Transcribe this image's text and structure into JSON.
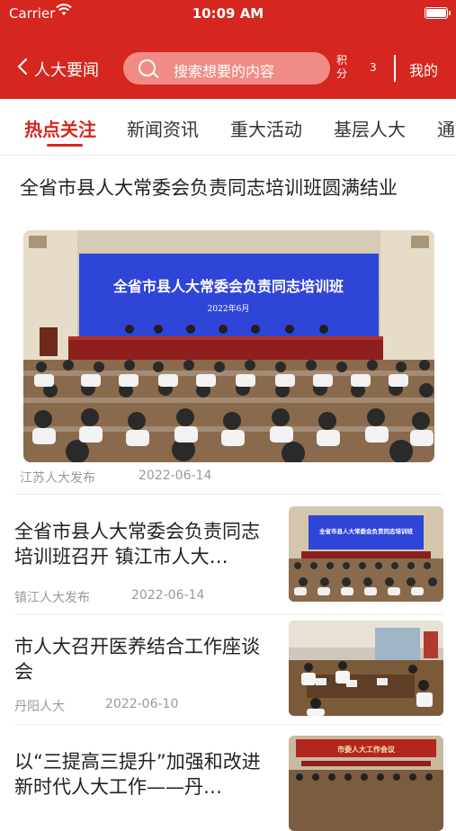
{
  "status_bar": {
    "carrier": "Carrier",
    "time": "10:09 AM",
    "battery_level": 1.0
  },
  "nav": {
    "back_label": "人大要闻",
    "search_placeholder": "搜索想要的内容",
    "points_label": "积分",
    "points_value": "3",
    "mine_label": "我的"
  },
  "tabs": [
    {
      "label": "热点关注",
      "active": true
    },
    {
      "label": "新闻资讯",
      "active": false
    },
    {
      "label": "重大活动",
      "active": false
    },
    {
      "label": "基层人大",
      "active": false
    },
    {
      "label": "通",
      "active": false
    }
  ],
  "feature": {
    "title": "全省市县人大常委会负责同志培训班圆满结业",
    "banner_text": "全省市县人大常委会负责同志培训班",
    "banner_date": "2022年6月",
    "source": "江苏人大发布",
    "date": "2022-06-14"
  },
  "articles": [
    {
      "title": "全省市县人大常委会负责同志培训班召开 镇江市人大…",
      "source": "镇江人大发布",
      "date": "2022-06-14",
      "thumb_banner": "全省市县人大常委会负责同志培训班"
    },
    {
      "title": "市人大召开医养结合工作座谈会",
      "source": "丹阳人大",
      "date": "2022-06-10"
    },
    {
      "title": "以“三提高三提升”加强和改进新时代人大工作——丹…",
      "thumb_banner": "市委人大工作会议"
    }
  ],
  "colors": {
    "brand_red": "#d5271f",
    "search_bg": "#f08c86",
    "banner_blue": "#2f45d8"
  }
}
